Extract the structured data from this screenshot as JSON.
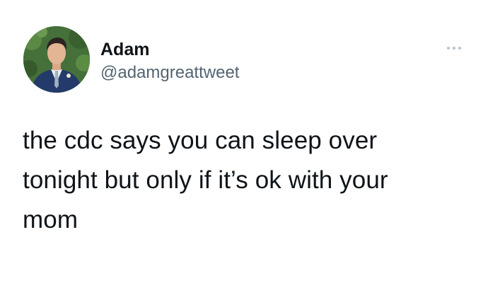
{
  "tweet": {
    "author": {
      "name": "Adam",
      "handle": "@adamgreattweet"
    },
    "text_lines": [
      "the cdc says you can sleep over",
      "tonight but only if it’s ok with your",
      "mom"
    ]
  },
  "icons": {
    "more": "more-horizontal-icon"
  },
  "colors": {
    "text_primary": "#0f1419",
    "text_secondary": "#536471",
    "icon_muted": "#b8c2cc",
    "background": "#ffffff"
  }
}
